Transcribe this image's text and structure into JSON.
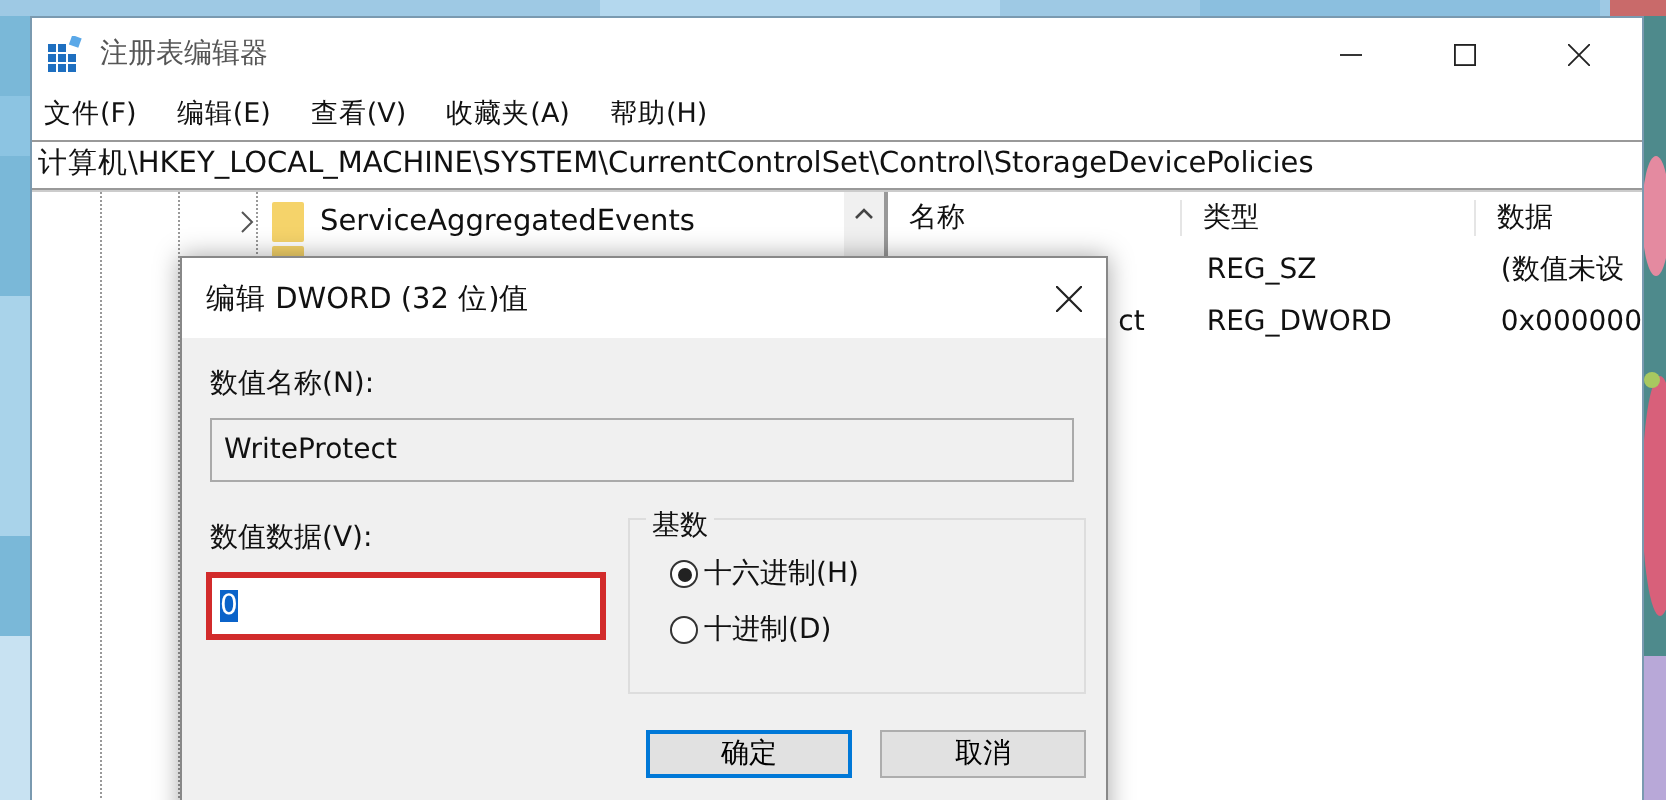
{
  "window": {
    "title": "注册表编辑器"
  },
  "menu": [
    {
      "label": "文件(F)"
    },
    {
      "label": "编辑(E)"
    },
    {
      "label": "查看(V)"
    },
    {
      "label": "收藏夹(A)"
    },
    {
      "label": "帮助(H)"
    }
  ],
  "address": "计算机\\HKEY_LOCAL_MACHINE\\SYSTEM\\CurrentControlSet\\Control\\StorageDevicePolicies",
  "tree": {
    "items": [
      {
        "label": "ServiceAggregatedEvents",
        "expanded": false
      }
    ]
  },
  "list": {
    "columns": [
      "名称",
      "类型",
      "数据"
    ],
    "rows": [
      {
        "type": "REG_SZ",
        "data": "(数值未设"
      },
      {
        "name": "ct",
        "type": "REG_DWORD",
        "data": "0x000000"
      }
    ]
  },
  "dialog": {
    "title": "编辑 DWORD (32 位)值",
    "name_label": "数值名称(N):",
    "name_value": "WriteProtect",
    "data_label": "数值数据(V):",
    "data_value": "0",
    "text_selected": true,
    "highlighted": true,
    "base": {
      "label": "基数",
      "options": [
        {
          "label": "十六进制(H)",
          "selected": true
        },
        {
          "label": "十进制(D)",
          "selected": false
        }
      ]
    },
    "buttons": [
      {
        "label": "确定",
        "default": true
      },
      {
        "label": "取消",
        "default": false
      }
    ]
  }
}
